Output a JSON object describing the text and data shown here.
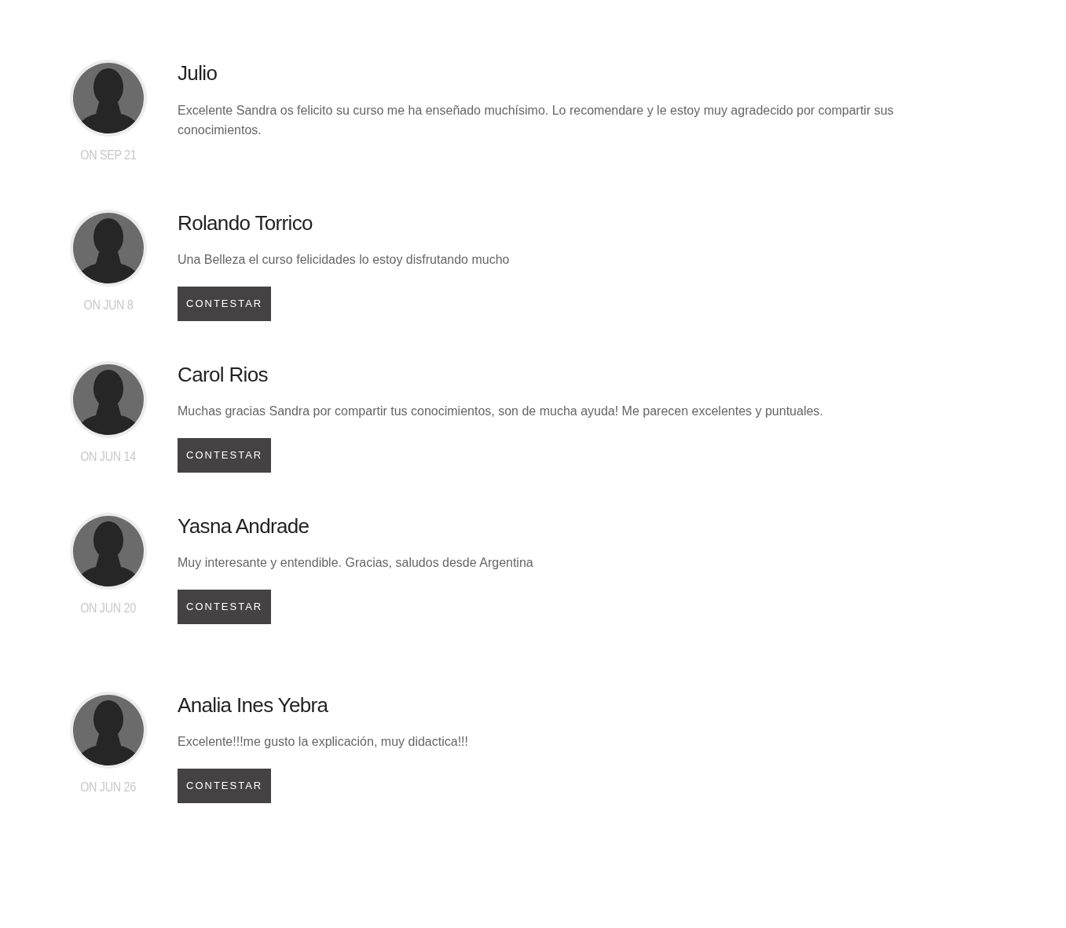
{
  "comments": [
    {
      "name": "Julio",
      "date": "ON SEP 21",
      "text": "Excelente Sandra os felicito su curso me ha enseñado muchísimo. Lo recomendare y le estoy muy agradecido por compartir sus conocimientos."
    },
    {
      "name": "Rolando Torrico",
      "date": "ON JUN 8",
      "text": "Una Belleza el curso felicidades lo estoy disfrutando mucho",
      "reply_button": "CONTESTAR"
    },
    {
      "name": "Carol Rios",
      "date": "ON JUN 14",
      "text": "Muchas gracias Sandra por compartir tus conocimientos, son de mucha ayuda! Me parecen excelentes y puntuales.",
      "reply_button": "CONTESTAR"
    },
    {
      "name": "Yasna Andrade",
      "date": "ON JUN 20",
      "text": "Muy interesante y entendible. Gracias, saludos desde Argentina",
      "reply_button": "CONTESTAR"
    },
    {
      "name": "Analia Ines Yebra",
      "date": "ON JUN 26",
      "text": "Excelente!!!me gusto la explicación, muy didactica!!!",
      "reply_button": "CONTESTAR"
    }
  ]
}
